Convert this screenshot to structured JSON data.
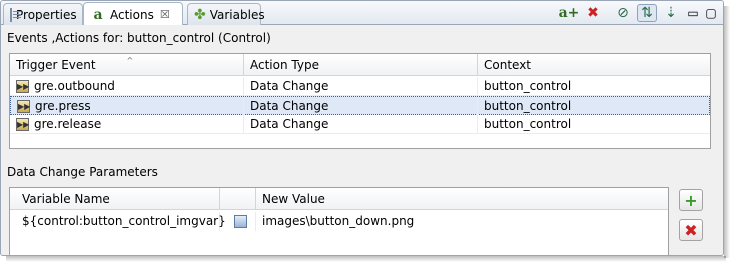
{
  "tabs": [
    {
      "label": "Properties"
    },
    {
      "label": "Actions",
      "close": "☒"
    },
    {
      "label": "Variables"
    }
  ],
  "toolbar": {
    "add_icon": "a+",
    "delete_icon": "✖",
    "filter_icon": "⊘",
    "sort_icon": "⇅",
    "link_icon": "⇣",
    "minimize_icon": "▭",
    "maximize_icon": "▢"
  },
  "events_section": {
    "title": "Events ,Actions for: button_control (Control)",
    "columns": [
      "Trigger Event",
      "Action Type",
      "Context"
    ],
    "sort_indicator": "^",
    "rows": [
      {
        "trigger": "gre.outbound",
        "action": "Data Change",
        "context": "button_control",
        "selected": false
      },
      {
        "trigger": "gre.press",
        "action": "Data Change",
        "context": "button_control",
        "selected": true
      },
      {
        "trigger": "gre.release",
        "action": "Data Change",
        "context": "button_control",
        "selected": false
      }
    ]
  },
  "params_section": {
    "title": "Data Change Parameters",
    "columns": [
      "Variable Name",
      "",
      "New Value"
    ],
    "rows": [
      {
        "name": "${control:button_control_imgvar}",
        "value": "images\\button_down.png"
      }
    ],
    "add_button": "+",
    "remove_button": "✖"
  },
  "colors": {
    "selection": "#dfe8f6",
    "add_green": "#3a9a2a",
    "delete_red": "#cc2222"
  }
}
